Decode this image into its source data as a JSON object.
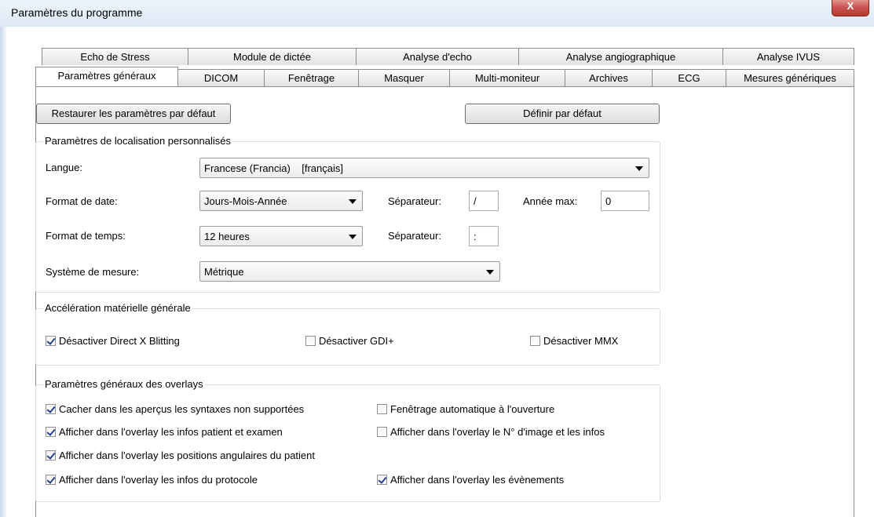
{
  "window": {
    "title": "Paramètres du programme",
    "close_label": "X"
  },
  "tabs_row1": [
    "Echo de Stress",
    "Module de dictée",
    "Analyse d'echo",
    "Analyse angiographique",
    "Analyse IVUS"
  ],
  "tabs_row2": [
    "Paramètres généraux",
    "DICOM",
    "Fenêtrage",
    "Masquer",
    "Multi-moniteur",
    "Archives",
    "ECG",
    "Mesures génériques"
  ],
  "active_tab": "Paramètres généraux",
  "buttons": {
    "restore": "Restaurer les paramètres par défaut",
    "set_default": "Définir par défaut"
  },
  "localisation": {
    "title": "Paramètres de localisation personnalisés",
    "language_label": "Langue:",
    "language_value": "Francese (Francia)    [français]",
    "date_format_label": "Format de date:",
    "date_format_value": "Jours-Mois-Année",
    "date_separator_label": "Séparateur:",
    "date_separator_value": "/",
    "year_max_label": "Année max:",
    "year_max_value": "0",
    "time_format_label": "Format de temps:",
    "time_format_value": "12 heures",
    "time_separator_label": "Séparateur:",
    "time_separator_value": ":",
    "measure_label": "Système de mesure:",
    "measure_value": "Métrique"
  },
  "acceleration": {
    "title": "Accélération matérielle générale",
    "options": [
      {
        "label": "Désactiver Direct X Blitting",
        "checked": true
      },
      {
        "label": "Désactiver GDI+",
        "checked": false
      },
      {
        "label": "Désactiver MMX",
        "checked": false
      }
    ]
  },
  "overlays": {
    "title": "Paramètres généraux des overlays",
    "left": [
      {
        "label": "Cacher dans les aperçus les syntaxes non supportées",
        "checked": true
      },
      {
        "label": "Afficher dans l'overlay les infos patient et examen",
        "checked": true
      },
      {
        "label": "Afficher dans l'overlay les positions angulaires du patient",
        "checked": true
      },
      {
        "label": "Afficher dans l'overlay les infos du protocole",
        "checked": true
      }
    ],
    "right": [
      {
        "label": "Fenêtrage automatique à l'ouverture",
        "checked": false
      },
      {
        "label": "Afficher dans l'overlay le N° d'image et les infos",
        "checked": false
      },
      {
        "label": "Afficher dans l'overlay les évènements",
        "checked": true
      }
    ]
  }
}
